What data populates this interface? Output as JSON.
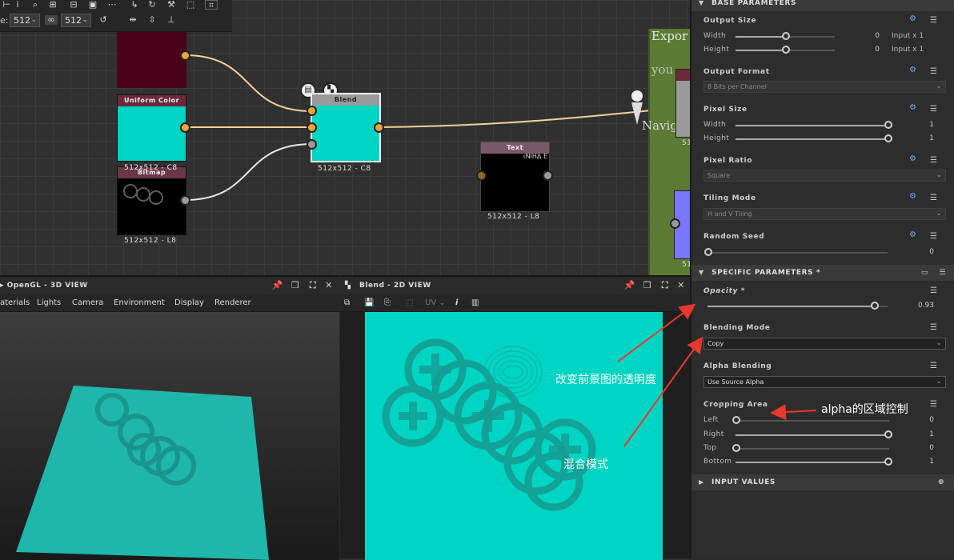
{
  "toolbar": {
    "size_label": "e:",
    "width_value": "512",
    "height_value": "512"
  },
  "graph": {
    "nodes": {
      "color_node_caption": "",
      "uniform_color": {
        "title": "Uniform Color"
      },
      "bitmap": {
        "title": "Bitmap",
        "overlay": "512x512 - C8",
        "caption": "512x512 - L8"
      },
      "blend": {
        "title": "Blend",
        "caption": "512x512 - C8"
      },
      "text": {
        "title": "Text",
        "caption": "512x512 - L8",
        "preview": "ιΝΙΗΔ Ε"
      }
    },
    "side_panel": {
      "label_export": "Expor",
      "label_you": "you",
      "label_navig": "Naviga",
      "cap_1": "51",
      "cap_2": "51"
    }
  },
  "panel3d": {
    "title": "OpenGL - 3D VIEW",
    "menu": [
      "aterials",
      "Lights",
      "Camera",
      "Environment",
      "Display",
      "Renderer"
    ]
  },
  "panel2d": {
    "title": "Blend - 2D VIEW",
    "uv_label": "UV"
  },
  "properties": {
    "base_section": "BASE PARAMETERS",
    "output_size": {
      "label": "Output Size",
      "width_label": "Width",
      "width_val": "0",
      "width_input": "Input x 1",
      "height_label": "Height",
      "height_val": "0",
      "height_input": "Input x 1"
    },
    "output_format": {
      "label": "Output Format",
      "value": "8 Bits per Channel"
    },
    "pixel_size": {
      "label": "Pixel Size",
      "width_label": "Width",
      "width_val": "1",
      "height_label": "Height",
      "height_val": "1"
    },
    "pixel_ratio": {
      "label": "Pixel Ratio",
      "value": "Square"
    },
    "tiling_mode": {
      "label": "Tiling Mode",
      "value": "H and V Tiling"
    },
    "random_seed": {
      "label": "Random Seed",
      "value": "0"
    },
    "specific_section": "SPECIFIC PARAMETERS *",
    "opacity": {
      "label": "Opacity *",
      "value": "0.93",
      "fraction": 0.93
    },
    "blending_mode": {
      "label": "Blending Mode",
      "value": "Copy"
    },
    "alpha_blending": {
      "label": "Alpha Blending",
      "value": "Use Source Alpha"
    },
    "cropping": {
      "label": "Cropping Area",
      "left_label": "Left",
      "left_val": "0",
      "right_label": "Right",
      "right_val": "1",
      "top_label": "Top",
      "top_val": "0",
      "bottom_label": "Bottom",
      "bottom_val": "1"
    },
    "input_section": "INPUT VALUES"
  },
  "annotations": {
    "opacity_note": "改变前景图的透明度",
    "blend_note": "混合模式",
    "alpha_note": "alpha的区域控制"
  },
  "colors": {
    "teal": "#00d4c3",
    "orange_port": "#f2a33a",
    "annotation_arrow": "#e8382e"
  }
}
